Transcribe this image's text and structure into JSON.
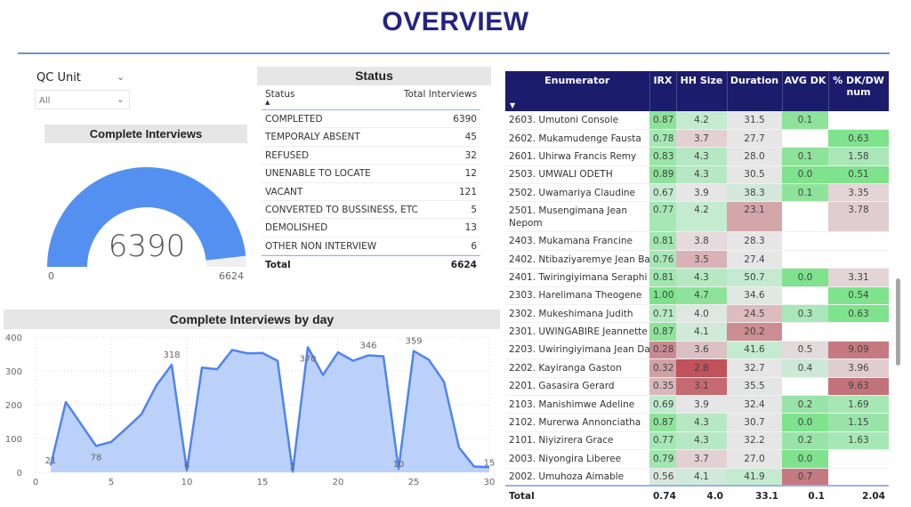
{
  "page": {
    "title": "OVERVIEW",
    "accent_color": "#232384",
    "rule_color": "#6f8fd3"
  },
  "slicer": {
    "label": "QC Unit",
    "selected": "All",
    "chevron_icon": "chevron-down-icon"
  },
  "gauge": {
    "title": "Complete Interviews",
    "value": 6390,
    "value_label": "6390",
    "min": 0,
    "min_label": "0",
    "max": 6624,
    "max_label": "6624",
    "fill_color": "#5390f0",
    "track_color": "#efefef"
  },
  "status": {
    "title": "Status",
    "columns": [
      "Status",
      "Total Interviews"
    ],
    "rows": [
      {
        "status": "COMPLETED",
        "total": "6390"
      },
      {
        "status": "TEMPORALY ABSENT",
        "total": "45"
      },
      {
        "status": "REFUSED",
        "total": "32"
      },
      {
        "status": "UNENABLE TO LOCATE",
        "total": "12"
      },
      {
        "status": "VACANT",
        "total": "121"
      },
      {
        "status": "CONVERTED TO BUSSINESS, ETC",
        "total": "5"
      },
      {
        "status": "DEMOLISHED",
        "total": "13"
      },
      {
        "status": "OTHER NON INTERVIEW",
        "total": "6"
      }
    ],
    "total_label": "Total",
    "total_value": "6624"
  },
  "chart_data": {
    "type": "area",
    "title": "Complete Interviews by day",
    "xlabel": "",
    "ylabel": "",
    "x": [
      1,
      2,
      3,
      4,
      5,
      6,
      7,
      8,
      9,
      10,
      11,
      12,
      13,
      14,
      15,
      16,
      17,
      18,
      19,
      20,
      21,
      22,
      23,
      24,
      25,
      26,
      27,
      28,
      29,
      30
    ],
    "series": [
      {
        "name": "Complete Interviews",
        "values": [
          21,
          208,
          143,
          78,
          90,
          130,
          172,
          258,
          318,
          6,
          310,
          305,
          362,
          352,
          353,
          330,
          2,
          370,
          288,
          355,
          330,
          346,
          343,
          10,
          359,
          333,
          268,
          73,
          17,
          15
        ]
      }
    ],
    "data_labels": [
      {
        "x": 1,
        "label": "21"
      },
      {
        "x": 4,
        "label": "78"
      },
      {
        "x": 9,
        "label": "318"
      },
      {
        "x": 10,
        "label": "6"
      },
      {
        "x": 17,
        "label": "2"
      },
      {
        "x": 18,
        "label": "370"
      },
      {
        "x": 22,
        "label": "346"
      },
      {
        "x": 24,
        "label": "10"
      },
      {
        "x": 25,
        "label": "359"
      },
      {
        "x": 30,
        "label": "15"
      }
    ],
    "xlim": [
      0,
      30
    ],
    "ylim": [
      0,
      400
    ],
    "xticks": [
      0,
      5,
      10,
      15,
      20,
      25,
      30
    ],
    "yticks": [
      0,
      100,
      200,
      300,
      400
    ],
    "grid": true,
    "line_color": "#4f84ee",
    "fill_color": "#bcd1fa"
  },
  "enumerators": {
    "columns": [
      "Enumerator",
      "IRX",
      "HH Size",
      "Duration",
      "AVG DK",
      "% DK/DW num"
    ],
    "rows": [
      {
        "name": "2603. Umutoni Console",
        "irx": "0.87",
        "hh": "4.2",
        "dur": "31.5",
        "dk": "0.1",
        "pct": "",
        "c": [
          "#8ee39a",
          "#c4ebcf",
          "#e6e6e6",
          "#8ee39a",
          "#ffffff"
        ]
      },
      {
        "name": "2602. Mukamudenge Fausta",
        "irx": "0.78",
        "hh": "3.7",
        "dur": "27.7",
        "dk": "",
        "pct": "0.63",
        "c": [
          "#a6e8b5",
          "#e3d0d2",
          "#e6e6e6",
          "#ffffff",
          "#7ee38c"
        ]
      },
      {
        "name": "2601. Uhirwa Francis Remy",
        "irx": "0.83",
        "hh": "4.3",
        "dur": "28.0",
        "dk": "0.1",
        "pct": "1.58",
        "c": [
          "#9ae6a9",
          "#b6e8c4",
          "#e6e6e6",
          "#8ee39a",
          "#a9e7b8"
        ]
      },
      {
        "name": "2503. UMWALI ODETH",
        "irx": "0.89",
        "hh": "4.3",
        "dur": "30.5",
        "dk": "0.0",
        "pct": "0.51",
        "c": [
          "#8ee39a",
          "#b6e8c4",
          "#e6e6e6",
          "#7ee38c",
          "#7ee38c"
        ]
      },
      {
        "name": "2502. Uwamariya Claudine",
        "irx": "0.67",
        "hh": "3.9",
        "dur": "38.3",
        "dk": "0.1",
        "pct": "3.35",
        "c": [
          "#c4ebcf",
          "#e6e6e6",
          "#d3e8da",
          "#8ee39a",
          "#e3d4d6"
        ]
      },
      {
        "name": "2501. Musengimana Jean Nepom",
        "irx": "0.77",
        "hh": "4.2",
        "dur": "23.1",
        "dk": "",
        "pct": "3.78",
        "c": [
          "#a6e8b5",
          "#c4ebcf",
          "#d3a6aa",
          "#ffffff",
          "#e0cdd0"
        ],
        "tall": true
      },
      {
        "name": "2403. Mukamana Francine",
        "irx": "0.81",
        "hh": "3.8",
        "dur": "28.3",
        "dk": "",
        "pct": "",
        "c": [
          "#a0e7b0",
          "#e6dadc",
          "#e6e6e6",
          "#ffffff",
          "#ffffff"
        ]
      },
      {
        "name": "2402. Ntibaziyaremye Jean Ba",
        "irx": "0.76",
        "hh": "3.5",
        "dur": "27.4",
        "dk": "",
        "pct": "",
        "c": [
          "#a6e8b5",
          "#d8b2b6",
          "#e6e6e6",
          "#ffffff",
          "#ffffff"
        ]
      },
      {
        "name": "2401. Twiringiyimana Seraphi",
        "irx": "0.81",
        "hh": "4.3",
        "dur": "50.7",
        "dk": "0.0",
        "pct": "3.31",
        "c": [
          "#a0e7b0",
          "#b6e8c4",
          "#c4ebcf",
          "#7ee38c",
          "#e3d4d6"
        ]
      },
      {
        "name": "2303. Harelimana Theogene",
        "irx": "1.00",
        "hh": "4.7",
        "dur": "34.6",
        "dk": "",
        "pct": "0.54",
        "c": [
          "#7ee38c",
          "#8ee39a",
          "#dfe8e2",
          "#ffffff",
          "#7ee38c"
        ]
      },
      {
        "name": "2302. Mukeshimana Judith",
        "irx": "0.71",
        "hh": "4.0",
        "dur": "24.5",
        "dk": "0.3",
        "pct": "0.63",
        "c": [
          "#b9eac6",
          "#dee8e1",
          "#dcbcbf",
          "#a9e7b8",
          "#7ee38c"
        ]
      },
      {
        "name": "2301. UWINGABIRE Jeannette",
        "irx": "0.87",
        "hh": "4.1",
        "dur": "20.2",
        "dk": "",
        "pct": "",
        "c": [
          "#8ee39a",
          "#d0e9d8",
          "#cb8d92",
          "#ffffff",
          "#ffffff"
        ]
      },
      {
        "name": "2203. Uwiringiyimana Jean Da",
        "irx": "0.28",
        "hh": "3.6",
        "dur": "41.6",
        "dk": "0.5",
        "pct": "9.09",
        "c": [
          "#c98a8f",
          "#dcc1c4",
          "#c4ebcf",
          "#e3dadb",
          "#c47a80"
        ]
      },
      {
        "name": "2202. Kayiranga Gaston",
        "irx": "0.32",
        "hh": "2.8",
        "dur": "32.7",
        "dk": "0.4",
        "pct": "3.96",
        "c": [
          "#d0a0a4",
          "#c05259",
          "#e6e6e6",
          "#cde8d5",
          "#e0cdd0"
        ]
      },
      {
        "name": "2201. Gasasira Gerard",
        "irx": "0.35",
        "hh": "3.1",
        "dur": "35.5",
        "dk": "",
        "pct": "9.63",
        "c": [
          "#d8b8bb",
          "#c56a70",
          "#e3e6e4",
          "#ffffff",
          "#c2737a"
        ]
      },
      {
        "name": "2103. Manishimwe Adeline",
        "irx": "0.69",
        "hh": "3.9",
        "dur": "32.4",
        "dk": "0.2",
        "pct": "1.69",
        "c": [
          "#bfeacb",
          "#e6e6e6",
          "#e6e6e6",
          "#98e4a8",
          "#a6e8b5"
        ]
      },
      {
        "name": "2102. Murerwa Annonciatha",
        "irx": "0.87",
        "hh": "4.3",
        "dur": "30.7",
        "dk": "0.0",
        "pct": "1.15",
        "c": [
          "#8ee39a",
          "#b6e8c4",
          "#e6e6e6",
          "#7ee38c",
          "#98e4a8"
        ]
      },
      {
        "name": "2101. Niyizirera Grace",
        "irx": "0.77",
        "hh": "4.3",
        "dur": "32.2",
        "dk": "0.2",
        "pct": "1.63",
        "c": [
          "#a6e8b5",
          "#b6e8c4",
          "#e6e6e6",
          "#98e4a8",
          "#a6e8b5"
        ]
      },
      {
        "name": "2003. Niyongira Liberee",
        "irx": "0.79",
        "hh": "3.7",
        "dur": "27.0",
        "dk": "0.0",
        "pct": "",
        "c": [
          "#a0e7b0",
          "#e3d0d2",
          "#e6e6e6",
          "#7ee38c",
          "#ffffff"
        ]
      },
      {
        "name": "2002. Umuhoza Aimable",
        "irx": "0.56",
        "hh": "4.1",
        "dur": "41.9",
        "dk": "0.7",
        "pct": "",
        "c": [
          "#dbe6de",
          "#d0e9d8",
          "#c4ebcf",
          "#c47a80",
          "#ffffff"
        ]
      }
    ],
    "total": {
      "label": "Total",
      "irx": "0.74",
      "hh": "4.0",
      "dur": "33.1",
      "dk": "0.1",
      "pct": "2.04"
    },
    "header_color": "#1c1c6c"
  }
}
